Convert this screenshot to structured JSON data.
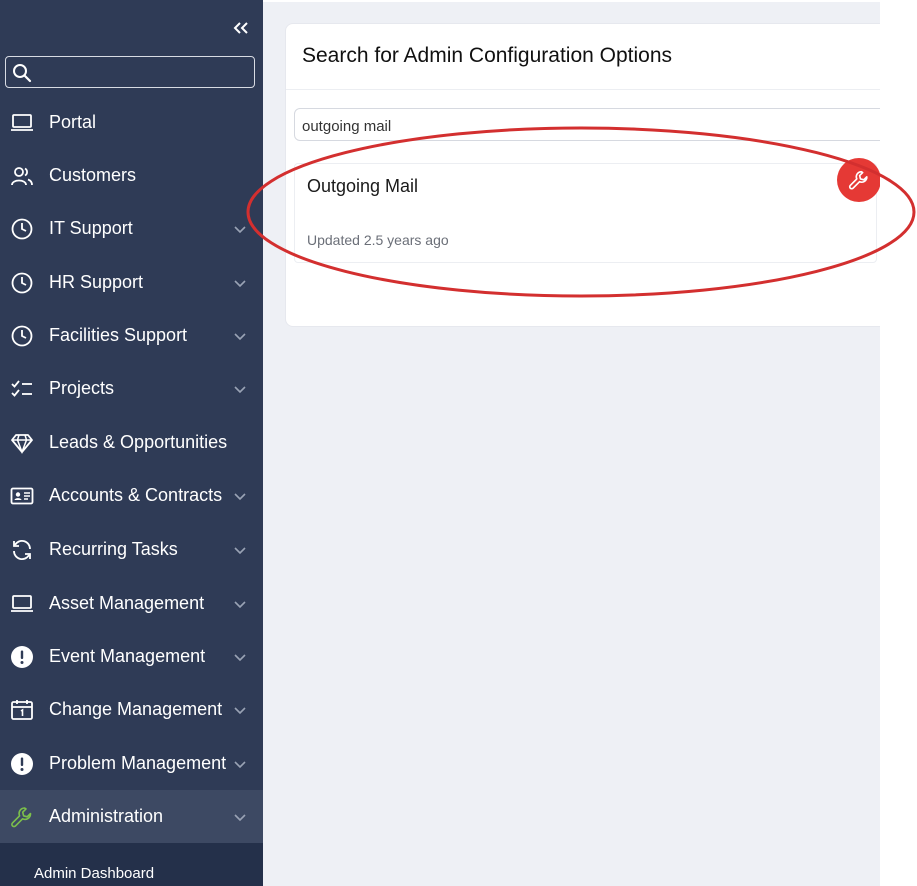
{
  "sidebar": {
    "search": {
      "placeholder": "",
      "value": ""
    },
    "items": [
      {
        "label": "Portal",
        "icon": "laptop-icon",
        "has_chevron": false
      },
      {
        "label": "Customers",
        "icon": "users-icon",
        "has_chevron": false
      },
      {
        "label": "IT Support",
        "icon": "clock-icon",
        "has_chevron": true
      },
      {
        "label": "HR Support",
        "icon": "clock-icon",
        "has_chevron": true
      },
      {
        "label": "Facilities Support",
        "icon": "clock-icon",
        "has_chevron": true
      },
      {
        "label": "Projects",
        "icon": "checklist-icon",
        "has_chevron": true
      },
      {
        "label": "Leads & Opportunities",
        "icon": "diamond-icon",
        "has_chevron": false
      },
      {
        "label": "Accounts & Contracts",
        "icon": "id-card-icon",
        "has_chevron": true
      },
      {
        "label": "Recurring Tasks",
        "icon": "refresh-icon",
        "has_chevron": true
      },
      {
        "label": "Asset Management",
        "icon": "laptop-icon",
        "has_chevron": true
      },
      {
        "label": "Event Management",
        "icon": "alert-icon",
        "has_chevron": true
      },
      {
        "label": "Change Management",
        "icon": "calendar-icon",
        "has_chevron": true
      },
      {
        "label": "Problem Management",
        "icon": "alert-icon",
        "has_chevron": true
      },
      {
        "label": "Administration",
        "icon": "wrench-icon",
        "has_chevron": true,
        "active": true
      }
    ],
    "sub_item": {
      "label": "Admin Dashboard"
    }
  },
  "main": {
    "card_title": "Search for Admin Configuration Options",
    "search": {
      "value": "outgoing mail"
    },
    "result": {
      "title": "Outgoing Mail",
      "updated": "Updated 2.5 years ago",
      "icon": "wrench-icon"
    }
  },
  "colors": {
    "sidebar_bg": "#2f3b56",
    "active_item_bg": "#3d4963",
    "active_icon": "#7cc04b",
    "badge_red": "#e53935",
    "annotation_red": "#d32f2f",
    "main_bg": "#eef0f5"
  }
}
